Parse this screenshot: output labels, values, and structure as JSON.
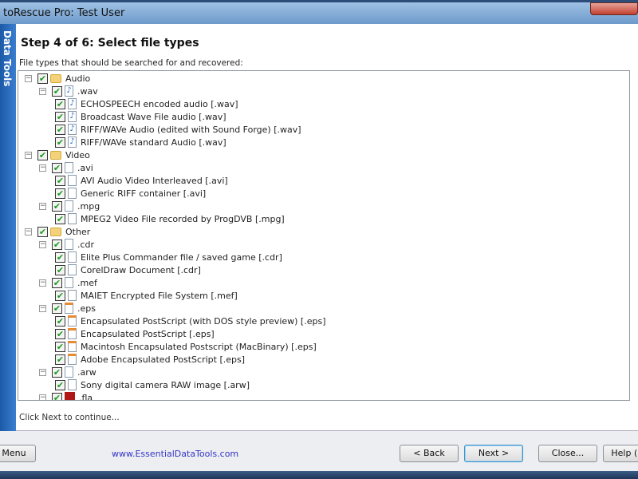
{
  "window": {
    "title": "toRescue Pro: Test User",
    "side_label": "Data Tools"
  },
  "heading": "Step 4 of 6: Select file types",
  "subheading": "File types that should be searched for and recovered:",
  "tree": [
    {
      "level": 0,
      "icon": "folder",
      "label": "Audio"
    },
    {
      "level": 1,
      "icon": "audio",
      "label": ".wav"
    },
    {
      "level": 2,
      "icon": "audio",
      "label": "ECHOSPEECH encoded audio [.wav]"
    },
    {
      "level": 2,
      "icon": "audio",
      "label": "Broadcast Wave File audio [.wav]"
    },
    {
      "level": 2,
      "icon": "audio",
      "label": "RIFF/WAVe Audio (edited with Sound Forge) [.wav]"
    },
    {
      "level": 2,
      "icon": "audio",
      "label": "RIFF/WAVe standard Audio [.wav]"
    },
    {
      "level": 0,
      "icon": "folder",
      "label": "Video"
    },
    {
      "level": 1,
      "icon": "file",
      "label": ".avi"
    },
    {
      "level": 2,
      "icon": "file",
      "label": "AVI Audio Video Interleaved [.avi]"
    },
    {
      "level": 2,
      "icon": "file",
      "label": "Generic RIFF container [.avi]"
    },
    {
      "level": 1,
      "icon": "file",
      "label": ".mpg"
    },
    {
      "level": 2,
      "icon": "file",
      "label": "MPEG2 Video File recorded by ProgDVB [.mpg]"
    },
    {
      "level": 0,
      "icon": "folder",
      "label": "Other"
    },
    {
      "level": 1,
      "icon": "file",
      "label": ".cdr"
    },
    {
      "level": 2,
      "icon": "file",
      "label": "Elite Plus Commander file / saved game [.cdr]"
    },
    {
      "level": 2,
      "icon": "file",
      "label": "CorelDraw Document [.cdr]"
    },
    {
      "level": 1,
      "icon": "file",
      "label": ".mef"
    },
    {
      "level": 2,
      "icon": "file",
      "label": "MAIET Encrypted File System [.mef]"
    },
    {
      "level": 1,
      "icon": "eps",
      "label": ".eps"
    },
    {
      "level": 2,
      "icon": "eps",
      "label": "Encapsulated PostScript (with DOS style preview) [.eps]"
    },
    {
      "level": 2,
      "icon": "eps",
      "label": "Encapsulated PostScript [.eps]"
    },
    {
      "level": 2,
      "icon": "eps",
      "label": "Macintosh Encapsulated Postscript (MacBinary) [.eps]"
    },
    {
      "level": 2,
      "icon": "eps",
      "label": "Adobe Encapsulated PostScript [.eps]"
    },
    {
      "level": 1,
      "icon": "file",
      "label": ".arw"
    },
    {
      "level": 2,
      "icon": "file",
      "label": "Sony digital camera RAW image [.arw]"
    },
    {
      "level": 1,
      "icon": "fla",
      "label": ".fla"
    }
  ],
  "status": "Click Next to continue...",
  "footer": {
    "menu": "Menu",
    "link": "www.EssentialDataTools.com",
    "back": "< Back",
    "next": "Next >",
    "close": "Close...",
    "help": "Help (F"
  }
}
